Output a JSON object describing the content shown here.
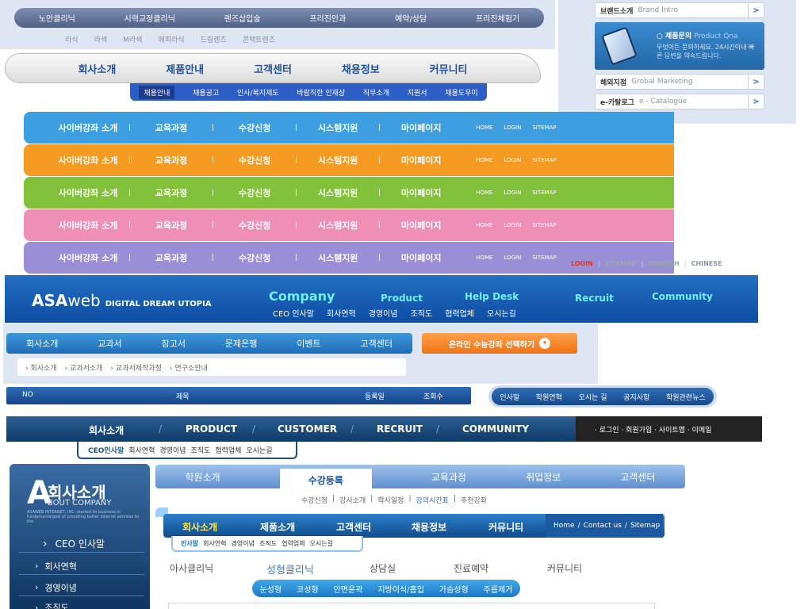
{
  "block1": {
    "main": [
      "노안클리닉",
      "시력교정클리닉",
      "렌즈삽입술",
      "프리진안과",
      "예약/상담",
      "프리진체험기"
    ],
    "sub": [
      "라식",
      "라섹",
      "M라섹",
      "에피라식",
      "드림렌즈",
      "콘택트렌즈"
    ]
  },
  "right_panel": {
    "brand": {
      "kr": "브랜드소개",
      "en": "Brand Intro"
    },
    "qna_title": "제품문의",
    "qna_en": "Product Qna",
    "qna_desc": "무엇이든 문의하세요. 24시간이내 빠른 답변을 약속드립니다.",
    "global": {
      "kr": "해외지점",
      "en": "Grobal Marketing"
    },
    "catalogue": {
      "kr": "e-카탈로그",
      "en": "e - Catalogue"
    },
    "arrow": ">"
  },
  "block2": {
    "main": [
      "회사소개",
      "제품안내",
      "고객센터",
      "채용정보",
      "커뮤니티"
    ],
    "sub": [
      "채용안내",
      "채용공고",
      "인사/복지제도",
      "바람직한 인재상",
      "직무소개",
      "지원서",
      "채용도우미"
    ]
  },
  "color_bars": {
    "items": [
      "사이버강좌 소개",
      "교육과정",
      "수강신청",
      "시스템지원",
      "마이페이지"
    ],
    "sep": "|",
    "small": [
      "HOME",
      "LOGIN",
      "SITEMAP"
    ],
    "colors": [
      "#3d9ee0",
      "#f59b22",
      "#82c23a",
      "#ef8fb6",
      "#9a8ed6"
    ]
  },
  "lang_links": {
    "login": "LOGIN",
    "sitemap": "SITEMAP",
    "english": "ENGLISH",
    "chinese": "CHINESE",
    "sep": "|"
  },
  "block4": {
    "logo_bold": "ASA",
    "logo_rest": "web",
    "tagline": "DIGITAL DREAM UTOPIA",
    "main": [
      "Company",
      "Product",
      "Help Desk",
      "Recruit",
      "Community"
    ],
    "sub": [
      "CEO 인사말",
      "회사연혁",
      "경영이념",
      "조직도",
      "협력업체",
      "오시는길"
    ]
  },
  "block5": {
    "main": [
      "회사소개",
      "교과서",
      "참고서",
      "문제은행",
      "이벤트",
      "고객센터"
    ],
    "button": "온라인 수능강좌 선택하기",
    "chevron": "▾",
    "sub": [
      "› 회사소개",
      "› 교과서소개",
      "› 교과서제작과정",
      "› 연구소안내"
    ]
  },
  "block6": {
    "cols": [
      "NO",
      "제목",
      "등록일",
      "조회수"
    ],
    "pill": [
      "인사말",
      "학원연혁",
      "오시는 길",
      "공지사항",
      "학원관련뉴스"
    ]
  },
  "block7": {
    "main": [
      "회사소개",
      "PRODUCT",
      "CUSTOMER",
      "RECRUIT",
      "COMMUNITY"
    ],
    "slash": "/",
    "util": "· 로그인 · 회원가입 · 사이트맵 · 이메일",
    "sub": [
      "CEO인사말",
      "회사연혁",
      "경영이념",
      "조직도",
      "협력업체",
      "오시는길"
    ]
  },
  "block8": {
    "big_letter": "A",
    "title": "회사소개",
    "en": "BOUT COMPANY",
    "desc": "ASAWEB INTERNET, INC. started its business in fundamentalgoal of providing better internet services to the",
    "items": [
      "CEO 인사말",
      "회사연혁",
      "경영이념",
      "조직도"
    ],
    "chev": "›"
  },
  "block9": {
    "main": [
      "학원소개",
      "수강등록",
      "교육과정",
      "취업정보",
      "고객센터"
    ],
    "sub": [
      "수강신청",
      "강사소개",
      "학사일정",
      "강의시간표",
      "추천강좌"
    ],
    "sep": "|"
  },
  "block10": {
    "main": [
      "회사소개",
      "제품소개",
      "고객센터",
      "채용정보",
      "커뮤니티"
    ],
    "util": [
      "Home",
      "/",
      "Contact us",
      "/",
      "Sitemap"
    ],
    "sub": [
      "인사말",
      "회사연혁",
      "경영이념",
      "조직도",
      "협력업체",
      "오시는길"
    ]
  },
  "block11": {
    "main": [
      "아사클리닉",
      "성형클리닉",
      "상담실",
      "진료예약",
      "커뮤니티"
    ],
    "sub": [
      "눈성형",
      "코성형",
      "안면윤곽",
      "지방이식/흡입",
      "가슴성형",
      "주름제거"
    ]
  }
}
